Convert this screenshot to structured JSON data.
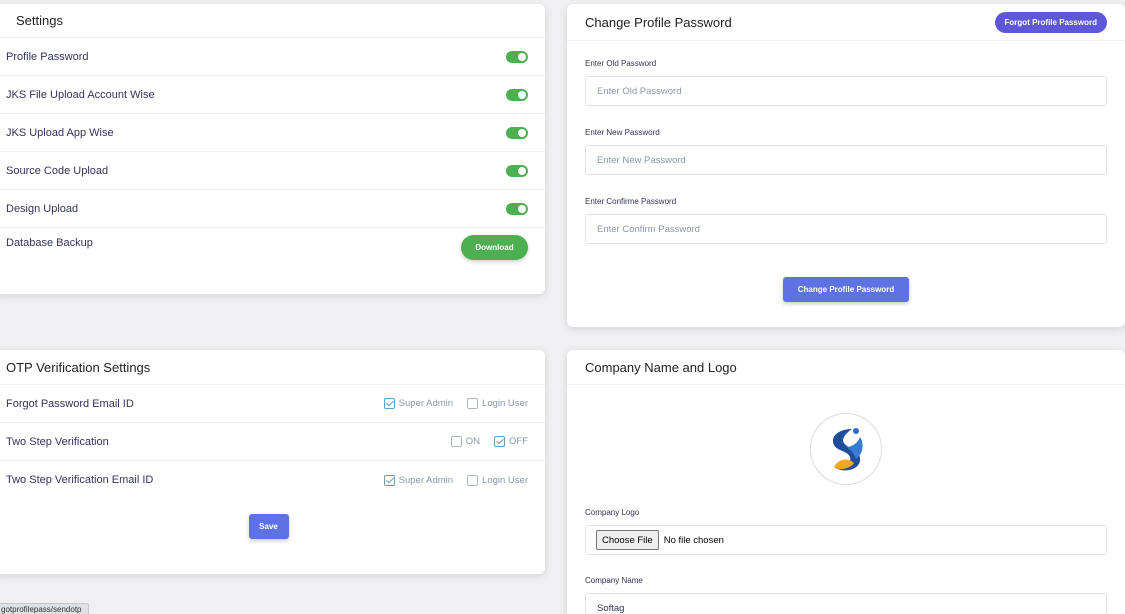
{
  "settings": {
    "title": "Settings",
    "toggles": [
      {
        "label": "Profile Password",
        "on": true
      },
      {
        "label": "JKS File Upload Account Wise",
        "on": true
      },
      {
        "label": "JKS Upload App Wise",
        "on": true
      },
      {
        "label": "Source Code Upload",
        "on": true
      },
      {
        "label": "Design Upload",
        "on": true
      }
    ],
    "backup_label": "Database Backup",
    "download_label": "Download"
  },
  "otp": {
    "title": "OTP Verification Settings",
    "rows": [
      {
        "label": "Forgot Password Email ID",
        "opt1": "Super Admin",
        "opt2": "Login User"
      },
      {
        "label": "Two Step Verification",
        "opt1": "ON",
        "opt2": "OFF"
      },
      {
        "label": "Two Step Verification Email ID",
        "opt1": "Super Admin",
        "opt2": "Login User"
      }
    ],
    "save_label": "Save"
  },
  "password": {
    "title": "Change Profile Password",
    "forgot_label": "Forgot Profile Password",
    "old_label": "Enter Old Password",
    "old_placeholder": "Enter Old Password",
    "new_label": "Enter New Password",
    "new_placeholder": "Enter New Password",
    "confirm_label": "Enter Confirme Password",
    "confirm_placeholder": "Enter Confirm Password",
    "submit_label": "Change Profile Password"
  },
  "company": {
    "title": "Company Name and Logo",
    "logo_label": "Company Logo",
    "choose_file": "Choose File",
    "no_file": "No file chosen",
    "name_label": "Company Name",
    "name_value": "Softag"
  },
  "status_url": "gotprofilepass/sendotp",
  "colors": {
    "toggle_on": "#4caf50",
    "primary": "#5e72e4",
    "pill": "#5e57d8"
  }
}
